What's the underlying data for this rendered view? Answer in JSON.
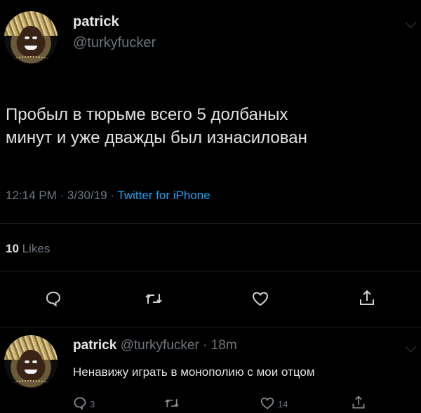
{
  "tweet": {
    "display_name": "patrick",
    "handle": "@turkyfucker",
    "text_line1": "Пробыл в тюрьме всего 5 долбаных",
    "text_line2": "минут и уже дважды был изнасилован",
    "time": "12:14 PM · 3/30/19 · ",
    "source": "Twitter for iPhone",
    "likes_count": "10",
    "likes_label": "Likes"
  },
  "reply": {
    "display_name": "patrick",
    "handle_time": "@turkyfucker · 18m",
    "text": "Ненавижу играть в монополию с мои отцом",
    "reply_count": "3",
    "like_count": "14"
  },
  "icons": [
    "reply-icon",
    "retweet-icon",
    "like-icon",
    "share-icon",
    "chevron-down-icon"
  ],
  "colors": {
    "background": "#000000",
    "accent": "#1da1f2",
    "muted": "#6e767d"
  }
}
